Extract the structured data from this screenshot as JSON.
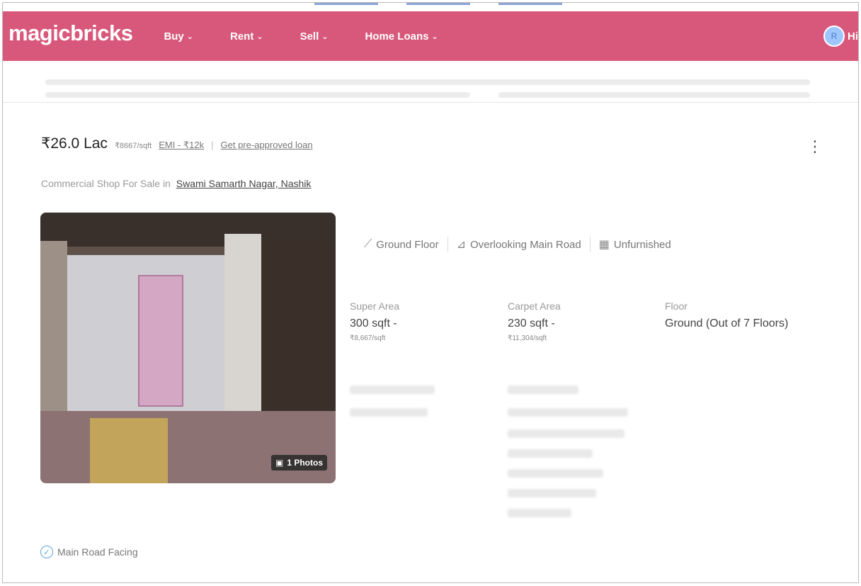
{
  "nav": {
    "logo": "magicbricks",
    "items": [
      "Buy",
      "Rent",
      "Sell",
      "Home Loans"
    ],
    "chevron": "⌄",
    "avatar_letter": "R",
    "user_label": "Hi"
  },
  "listing": {
    "price": "₹26.0 Lac",
    "price_per_sqft": "₹8667/sqft",
    "emi": "EMI - ₹12k",
    "separator": "|",
    "loan_link": "Get pre-approved loan",
    "subtitle_prefix": "Commercial Shop For Sale in",
    "location": "Swami Samarth Nagar, Nashik",
    "photos_badge": "1 Photos",
    "features": [
      "Ground Floor",
      "Overlooking Main Road",
      "Unfurnished"
    ],
    "stats": [
      {
        "label": "Super Area",
        "value": "300 sqft -",
        "sub": "₹8,667/sqft"
      },
      {
        "label": "Carpet Area",
        "value": "230 sqft -",
        "sub": "₹11,304/sqft"
      },
      {
        "label": "Floor",
        "value": "Ground (Out of 7 Floors)",
        "sub": ""
      }
    ],
    "facing": "Main Road Facing"
  },
  "colors": {
    "brand": "#d8587b",
    "accent": "#5aa0d8"
  }
}
